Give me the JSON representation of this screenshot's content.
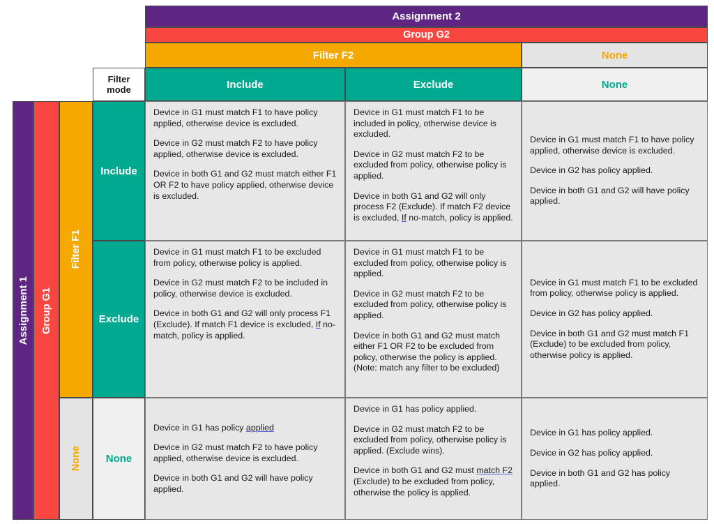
{
  "matrix": {
    "row_axis": {
      "assignment_label": "Assignment 1",
      "group_label": "Group G1",
      "filter_label": "Filter F1",
      "none_label": "None",
      "filter_mode_header": "Filter\nmode",
      "modes": [
        "Include",
        "Exclude",
        "None"
      ]
    },
    "col_axis": {
      "assignment_label": "Assignment 2",
      "group_label": "Group G2",
      "filter_label": "Filter F2",
      "none_label": "None",
      "modes": [
        "Include",
        "Exclude",
        "None"
      ]
    },
    "colors": {
      "assignment": "#5E2682",
      "group": "#FA4641",
      "filter": "#F5A800",
      "mode": "#00A98F",
      "none_dark": "#E4E4E4",
      "none_light": "#F0F0F0",
      "body": "#E7E7E7",
      "spellcheck_underline": "#5566DD"
    },
    "cells": [
      [
        {
          "paragraphs": [
            [
              {
                "t": "Device in G1 must match F1 to have policy applied, otherwise device is excluded."
              }
            ],
            [
              {
                "t": "Device in G2 must match F2 to have policy applied, otherwise device is excluded."
              }
            ],
            [
              {
                "t": "Device in both G1 and G2 must match either F1 OR F2 to have policy applied, otherwise device is excluded."
              }
            ]
          ]
        },
        {
          "paragraphs": [
            [
              {
                "t": "Device in G1 must match F1 to be included in policy, otherwise device is excluded."
              }
            ],
            [
              {
                "t": "Device in G2 must match F2 to be excluded from policy, otherwise policy is applied."
              }
            ],
            [
              {
                "t": "Device in both G1 and G2 will only process F2 (Exclude). If match F2 device is excluded, "
              },
              {
                "t": "If",
                "u": true
              },
              {
                "t": " no-match, policy is applied."
              }
            ]
          ]
        },
        {
          "paragraphs": [
            [
              {
                "t": "Device in G1 must match F1 to have policy applied, otherwise device is excluded."
              }
            ],
            [
              {
                "t": "Device in G2 has policy applied."
              }
            ],
            [
              {
                "t": "Device in both G1 and G2 will have policy applied."
              }
            ]
          ]
        }
      ],
      [
        {
          "paragraphs": [
            [
              {
                "t": "Device in G1 must match F1 to be excluded from policy, otherwise policy is applied."
              }
            ],
            [
              {
                "t": "Device in G2 must match F2 to be included in policy, otherwise device is excluded."
              }
            ],
            [
              {
                "t": "Device in both G1 and G2 will only process F1 (Exclude). If match F1 device is excluded, "
              },
              {
                "t": "If",
                "u": true
              },
              {
                "t": " no-match, policy is applied."
              }
            ]
          ]
        },
        {
          "paragraphs": [
            [
              {
                "t": "Device in G1 must match F1 to be excluded from policy, otherwise policy is applied."
              }
            ],
            [
              {
                "t": "Device in G2 must match F2 to be excluded from policy, otherwise policy is applied."
              }
            ],
            [
              {
                "t": "Device in both G1 and G2 must match either F1 OR F2 to be excluded from policy, otherwise the policy is applied. (Note: match any filter to be excluded)"
              }
            ]
          ]
        },
        {
          "paragraphs": [
            [
              {
                "t": "Device in G1 must match F1 to be excluded from policy, otherwise policy is applied."
              }
            ],
            [
              {
                "t": "Device in G2 has policy applied."
              }
            ],
            [
              {
                "t": "Device in both G1 and G2 must match F1 (Exclude) to be excluded from policy, otherwise policy is applied."
              }
            ]
          ]
        }
      ],
      [
        {
          "paragraphs": [
            [
              {
                "t": "Device in G1 has policy "
              },
              {
                "t": "applied",
                "u": true
              }
            ],
            [
              {
                "t": "Device in G2 must match F2 to have policy applied, otherwise device is excluded."
              }
            ],
            [
              {
                "t": "Device in both G1 and G2 will have policy applied."
              }
            ]
          ]
        },
        {
          "paragraphs": [
            [
              {
                "t": "Device in G1 has policy applied."
              }
            ],
            [
              {
                "t": "Device in G2 must match F2 to be excluded from policy, otherwise policy is applied. (Exclude wins)."
              }
            ],
            [
              {
                "t": "Device in both G1 and G2 must "
              },
              {
                "t": "match  F2",
                "u": true
              },
              {
                "t": " (Exclude) to be excluded from policy, otherwise the policy is applied."
              }
            ]
          ]
        },
        {
          "paragraphs": [
            [
              {
                "t": "Device in G1 has policy applied."
              }
            ],
            [
              {
                "t": "Device in G2 has policy applied."
              }
            ],
            [
              {
                "t": "Device in both G1 and G2 has policy applied."
              }
            ]
          ]
        }
      ]
    ]
  }
}
